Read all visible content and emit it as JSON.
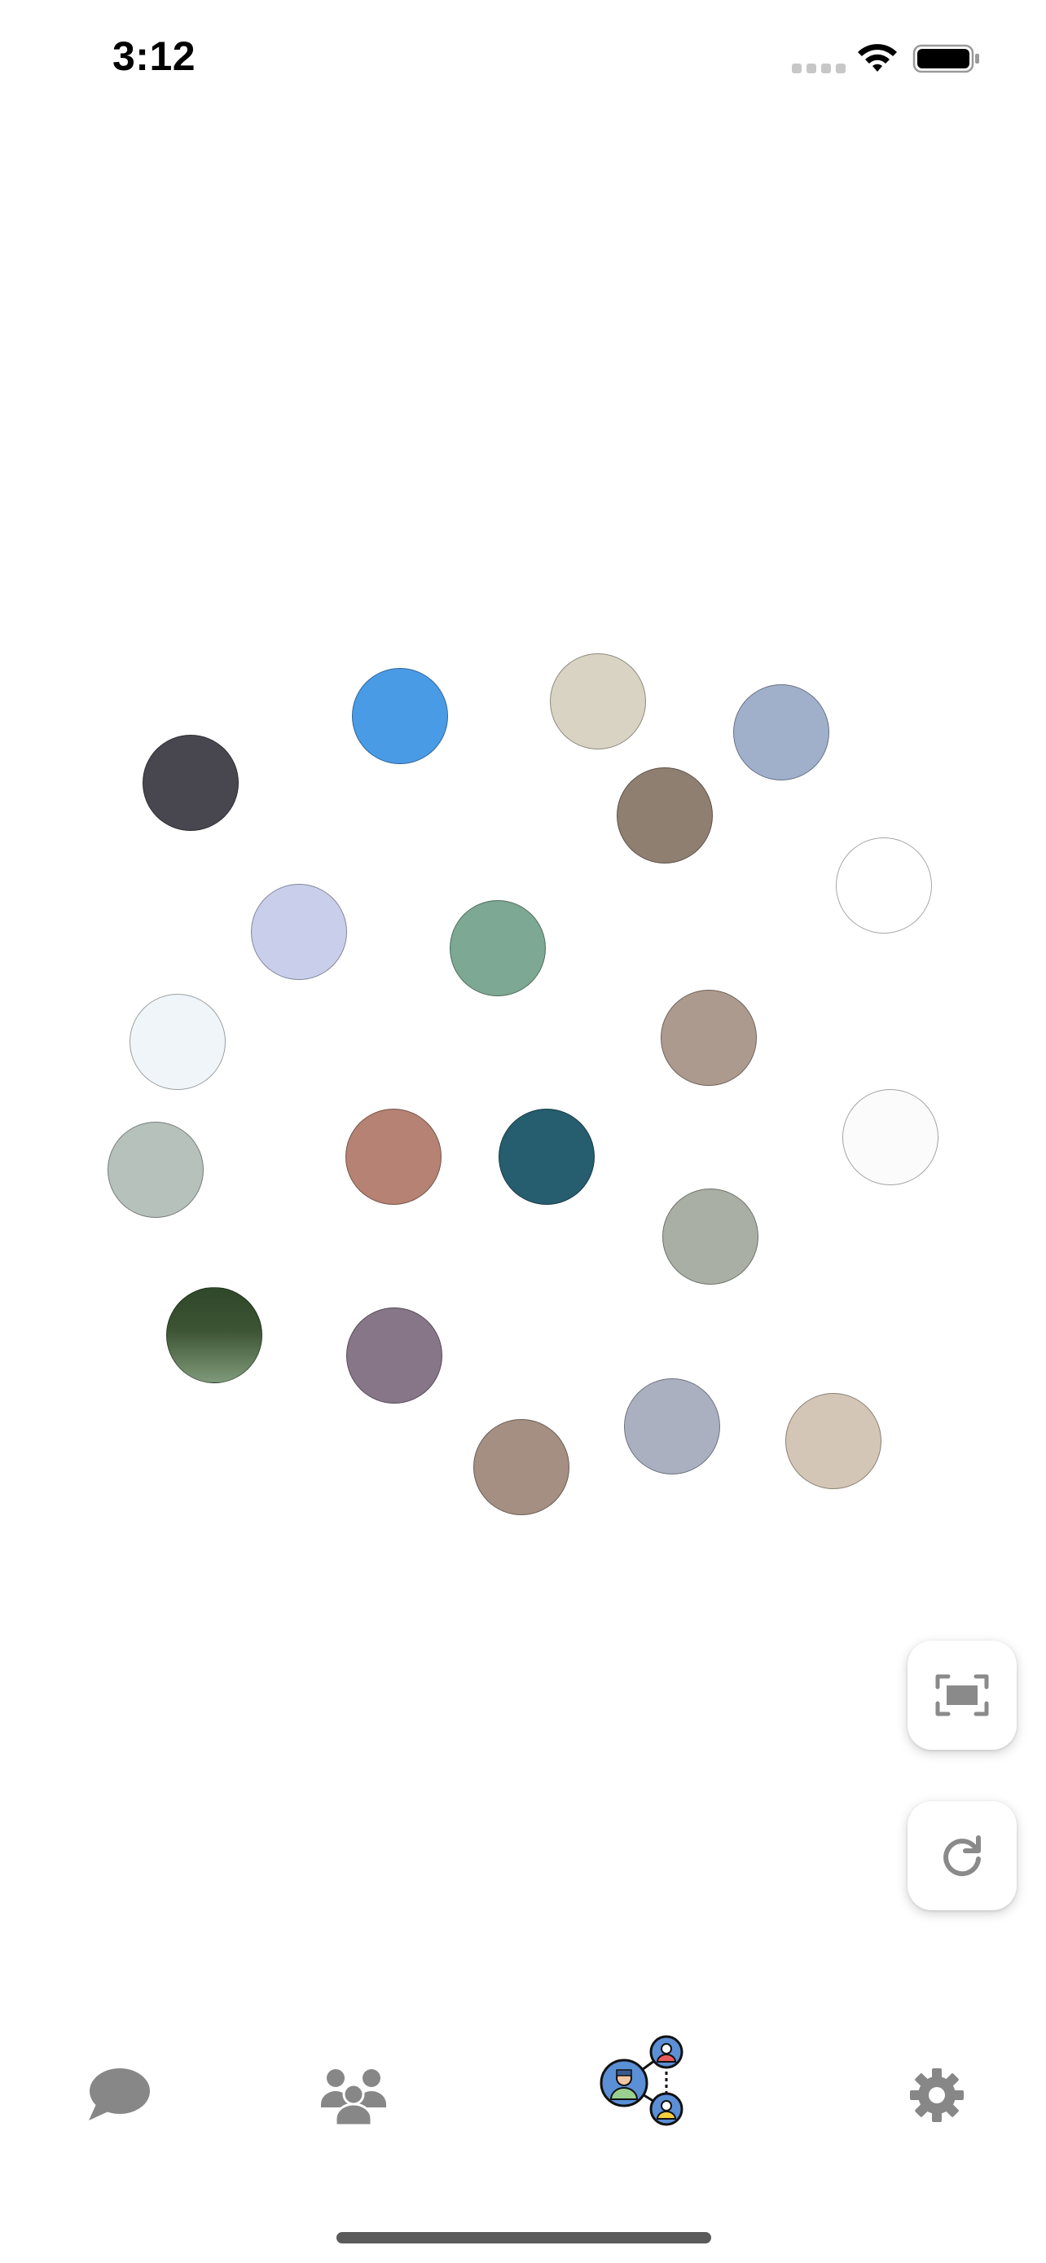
{
  "status_bar": {
    "time": "3:12"
  },
  "bubbles": [
    {
      "id": 1,
      "color": "#48464f"
    },
    {
      "id": 2,
      "color": "#4a9be6"
    },
    {
      "id": 3,
      "color": "#d9d3c3"
    },
    {
      "id": 4,
      "color": "#a0b0cb"
    },
    {
      "id": 5,
      "color": "#8f7f70"
    },
    {
      "id": 6,
      "color": "#ffffff"
    },
    {
      "id": 7,
      "color": "#c9cfea"
    },
    {
      "id": 8,
      "color": "#7da893"
    },
    {
      "id": 9,
      "color": "#ac9a8e"
    },
    {
      "id": 10,
      "color": "#eff5f9"
    },
    {
      "id": 11,
      "color": "#b6c1bc"
    },
    {
      "id": 12,
      "color": "#b58273"
    },
    {
      "id": 13,
      "color": "#265d6f"
    },
    {
      "id": 14,
      "color": "#fbfbfb"
    },
    {
      "id": 15,
      "color": "#a9afa5"
    },
    {
      "id": 16,
      "color": "#3a5033"
    },
    {
      "id": 17,
      "color": "#867688"
    },
    {
      "id": 18,
      "color": "#a48f82"
    },
    {
      "id": 19,
      "color": "#aab0c0"
    },
    {
      "id": 20,
      "color": "#d3c6b6"
    }
  ],
  "tabs": [
    {
      "id": "chats",
      "icon": "chat-bubble-icon",
      "selected": false
    },
    {
      "id": "groups",
      "icon": "people-group-icon",
      "selected": false
    },
    {
      "id": "network",
      "icon": "network-users-icon",
      "selected": true
    },
    {
      "id": "settings",
      "icon": "gear-icon",
      "selected": false
    }
  ],
  "actions": {
    "fit_view": "fit-to-screen-icon",
    "refresh": "refresh-icon"
  }
}
